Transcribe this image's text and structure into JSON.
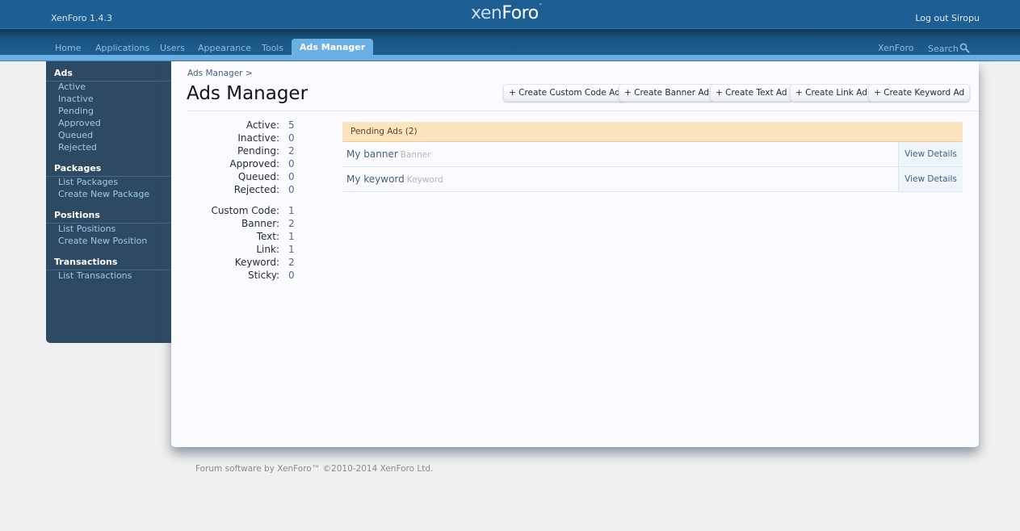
{
  "header": {
    "version": "XenForo 1.4.3",
    "logo": {
      "part1": "xen",
      "part2": "Foro",
      "tm": "™"
    },
    "logout": "Log out Siropu"
  },
  "nav": {
    "tabs": [
      {
        "label": "Home"
      },
      {
        "label": "Applications"
      },
      {
        "label": "Users"
      },
      {
        "label": "Appearance"
      },
      {
        "label": "Tools"
      },
      {
        "label": "Ads Manager",
        "active": true
      }
    ],
    "right_links": {
      "xenforo": "XenForo",
      "search": "Search"
    }
  },
  "sidebar": {
    "sections": [
      {
        "heading": "Ads",
        "items": [
          "Active",
          "Inactive",
          "Pending",
          "Approved",
          "Queued",
          "Rejected"
        ]
      },
      {
        "heading": "Packages",
        "items": [
          "List Packages",
          "Create New Package"
        ]
      },
      {
        "heading": "Positions",
        "items": [
          "List Positions",
          "Create New Position"
        ]
      },
      {
        "heading": "Transactions",
        "items": [
          "List Transactions"
        ]
      }
    ]
  },
  "main": {
    "breadcrumb": "Ads Manager >",
    "title": "Ads Manager",
    "buttons": [
      "+ Create Custom Code Ad",
      "+ Create Banner Ad",
      "+ Create Text Ad",
      "+ Create Link Ad",
      "+ Create Keyword Ad"
    ],
    "status_stats": [
      {
        "label": "Active:",
        "value": "5"
      },
      {
        "label": "Inactive:",
        "value": "0"
      },
      {
        "label": "Pending:",
        "value": "2"
      },
      {
        "label": "Approved:",
        "value": "0"
      },
      {
        "label": "Queued:",
        "value": "0"
      },
      {
        "label": "Rejected:",
        "value": "0"
      }
    ],
    "type_stats": [
      {
        "label": "Custom Code:",
        "value": "1"
      },
      {
        "label": "Banner:",
        "value": "2"
      },
      {
        "label": "Text:",
        "value": "1"
      },
      {
        "label": "Link:",
        "value": "1"
      },
      {
        "label": "Keyword:",
        "value": "2"
      },
      {
        "label": "Sticky:",
        "value": "0"
      }
    ],
    "pending": {
      "header": "Pending Ads (2)",
      "rows": [
        {
          "title": "My banner",
          "type": "Banner",
          "action": "View Details"
        },
        {
          "title": "My keyword",
          "type": "Keyword",
          "action": "View Details"
        }
      ]
    }
  },
  "footer": "Forum software by XenForo™ ©2010-2014 XenForo Ltd."
}
